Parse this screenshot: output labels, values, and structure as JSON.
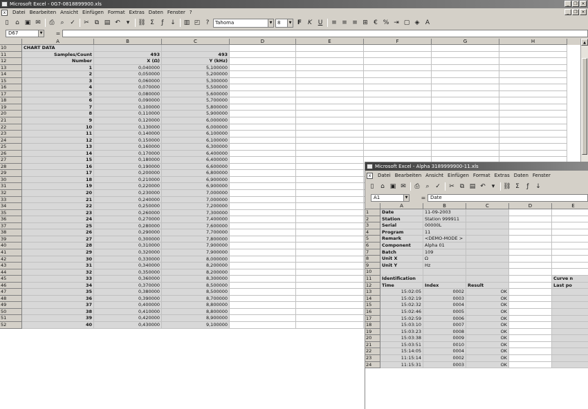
{
  "main": {
    "title": "Microsoft Excel - 0G7-0818899900.xls",
    "menu": [
      "Datei",
      "Bearbeiten",
      "Ansicht",
      "Einfügen",
      "Format",
      "Extras",
      "Daten",
      "Fenster",
      "?"
    ],
    "font_name": "Tahoma",
    "font_size": "8",
    "name_box": "D67",
    "formula_value": "",
    "columns": [
      "A",
      "B",
      "C",
      "D",
      "E",
      "F",
      "G",
      "H"
    ],
    "rows": [
      {
        "n": "10",
        "a": "CHART DATA",
        "b": "",
        "c": "",
        "hdr": true
      },
      {
        "n": "11",
        "a": "Samples/Count",
        "b": "493",
        "c": "493",
        "sub": true
      },
      {
        "n": "12",
        "a": "Number",
        "b": "X (Ω)",
        "c": "Y (kHz)",
        "sub": true
      },
      {
        "n": "13",
        "a": "1",
        "b": "0,040000",
        "c": "5,100000"
      },
      {
        "n": "14",
        "a": "2",
        "b": "0,050000",
        "c": "5,200000"
      },
      {
        "n": "15",
        "a": "3",
        "b": "0,060000",
        "c": "5,300000"
      },
      {
        "n": "16",
        "a": "4",
        "b": "0,070000",
        "c": "5,500000"
      },
      {
        "n": "17",
        "a": "5",
        "b": "0,080000",
        "c": "5,600000"
      },
      {
        "n": "18",
        "a": "6",
        "b": "0,090000",
        "c": "5,700000"
      },
      {
        "n": "19",
        "a": "7",
        "b": "0,100000",
        "c": "5,800000"
      },
      {
        "n": "20",
        "a": "8",
        "b": "0,110000",
        "c": "5,900000"
      },
      {
        "n": "21",
        "a": "9",
        "b": "0,120000",
        "c": "6,000000"
      },
      {
        "n": "22",
        "a": "10",
        "b": "0,130000",
        "c": "6,000000"
      },
      {
        "n": "23",
        "a": "11",
        "b": "0,140000",
        "c": "6,100000"
      },
      {
        "n": "24",
        "a": "12",
        "b": "0,150000",
        "c": "6,100000"
      },
      {
        "n": "25",
        "a": "13",
        "b": "0,160000",
        "c": "6,300000"
      },
      {
        "n": "26",
        "a": "14",
        "b": "0,170000",
        "c": "6,400000"
      },
      {
        "n": "27",
        "a": "15",
        "b": "0,180000",
        "c": "6,400000"
      },
      {
        "n": "28",
        "a": "16",
        "b": "0,190000",
        "c": "6,600000"
      },
      {
        "n": "29",
        "a": "17",
        "b": "0,200000",
        "c": "6,800000"
      },
      {
        "n": "30",
        "a": "18",
        "b": "0,210000",
        "c": "6,900000"
      },
      {
        "n": "31",
        "a": "19",
        "b": "0,220000",
        "c": "6,900000"
      },
      {
        "n": "32",
        "a": "20",
        "b": "0,230000",
        "c": "7,000000"
      },
      {
        "n": "33",
        "a": "21",
        "b": "0,240000",
        "c": "7,000000"
      },
      {
        "n": "34",
        "a": "22",
        "b": "0,250000",
        "c": "7,200000"
      },
      {
        "n": "35",
        "a": "23",
        "b": "0,260000",
        "c": "7,300000"
      },
      {
        "n": "36",
        "a": "24",
        "b": "0,270000",
        "c": "7,400000"
      },
      {
        "n": "37",
        "a": "25",
        "b": "0,280000",
        "c": "7,600000"
      },
      {
        "n": "38",
        "a": "26",
        "b": "0,290000",
        "c": "7,700000"
      },
      {
        "n": "39",
        "a": "27",
        "b": "0,300000",
        "c": "7,800000"
      },
      {
        "n": "40",
        "a": "28",
        "b": "0,310000",
        "c": "7,900000"
      },
      {
        "n": "41",
        "a": "29",
        "b": "0,320000",
        "c": "7,900000"
      },
      {
        "n": "42",
        "a": "30",
        "b": "0,330000",
        "c": "8,000000"
      },
      {
        "n": "43",
        "a": "31",
        "b": "0,340000",
        "c": "8,200000"
      },
      {
        "n": "44",
        "a": "32",
        "b": "0,350000",
        "c": "8,200000"
      },
      {
        "n": "45",
        "a": "33",
        "b": "0,360000",
        "c": "8,300000"
      },
      {
        "n": "46",
        "a": "34",
        "b": "0,370000",
        "c": "8,500000"
      },
      {
        "n": "47",
        "a": "35",
        "b": "0,380000",
        "c": "8,500000"
      },
      {
        "n": "48",
        "a": "36",
        "b": "0,390000",
        "c": "8,700000"
      },
      {
        "n": "49",
        "a": "37",
        "b": "0,400000",
        "c": "8,800000"
      },
      {
        "n": "50",
        "a": "38",
        "b": "0,410000",
        "c": "8,800000"
      },
      {
        "n": "51",
        "a": "39",
        "b": "0,420000",
        "c": "8,900000"
      },
      {
        "n": "52",
        "a": "40",
        "b": "0,430000",
        "c": "9,100000"
      }
    ]
  },
  "sub": {
    "title": "Microsoft Excel - Alpha 3189999900-11.xls",
    "menu": [
      "Datei",
      "Bearbeiten",
      "Ansicht",
      "Einfügen",
      "Format",
      "Extras",
      "Daten",
      "Fenster"
    ],
    "name_box": "A1",
    "formula_value": "Date",
    "columns": [
      "A",
      "B",
      "C",
      "D",
      "E"
    ],
    "info": [
      {
        "n": "1",
        "a": "Date",
        "b": "11-09-2003"
      },
      {
        "n": "2",
        "a": "Station",
        "b": "Station 999911"
      },
      {
        "n": "3",
        "a": "Serial",
        "b": "00000L"
      },
      {
        "n": "4",
        "a": "Program",
        "b": "11"
      },
      {
        "n": "5",
        "a": "Remark",
        "b": "<DEMO-MODE >"
      },
      {
        "n": "6",
        "a": "Component",
        "b": "Alpha 01"
      },
      {
        "n": "7",
        "a": "Batch",
        "b": "109"
      },
      {
        "n": "8",
        "a": "Unit X",
        "b": "Ω"
      },
      {
        "n": "9",
        "a": "Unit Y",
        "b": "Hz"
      },
      {
        "n": "10",
        "a": "",
        "b": ""
      }
    ],
    "ident_row": {
      "n": "11",
      "a": "Identification",
      "e": "Curve n"
    },
    "header_row": {
      "n": "12",
      "a": "Time",
      "b": "Index",
      "c": "Result",
      "e": "Last po"
    },
    "data": [
      {
        "n": "13",
        "a": "15:02:05",
        "b": "0002",
        "c": "OK"
      },
      {
        "n": "14",
        "a": "15:02:19",
        "b": "0003",
        "c": "OK"
      },
      {
        "n": "15",
        "a": "15:02:32",
        "b": "0004",
        "c": "OK"
      },
      {
        "n": "16",
        "a": "15:02:46",
        "b": "0005",
        "c": "OK"
      },
      {
        "n": "17",
        "a": "15:02:59",
        "b": "0006",
        "c": "OK"
      },
      {
        "n": "18",
        "a": "15:03:10",
        "b": "0007",
        "c": "OK"
      },
      {
        "n": "19",
        "a": "15:03:23",
        "b": "0008",
        "c": "OK"
      },
      {
        "n": "20",
        "a": "15:03:38",
        "b": "0009",
        "c": "OK"
      },
      {
        "n": "21",
        "a": "15:03:51",
        "b": "0010",
        "c": "OK"
      },
      {
        "n": "22",
        "a": "15:14:05",
        "b": "0004",
        "c": "OK"
      },
      {
        "n": "23",
        "a": "11:15:14",
        "b": "0002",
        "c": "OK"
      },
      {
        "n": "24",
        "a": "11:15:31",
        "b": "0003",
        "c": "OK"
      }
    ]
  }
}
